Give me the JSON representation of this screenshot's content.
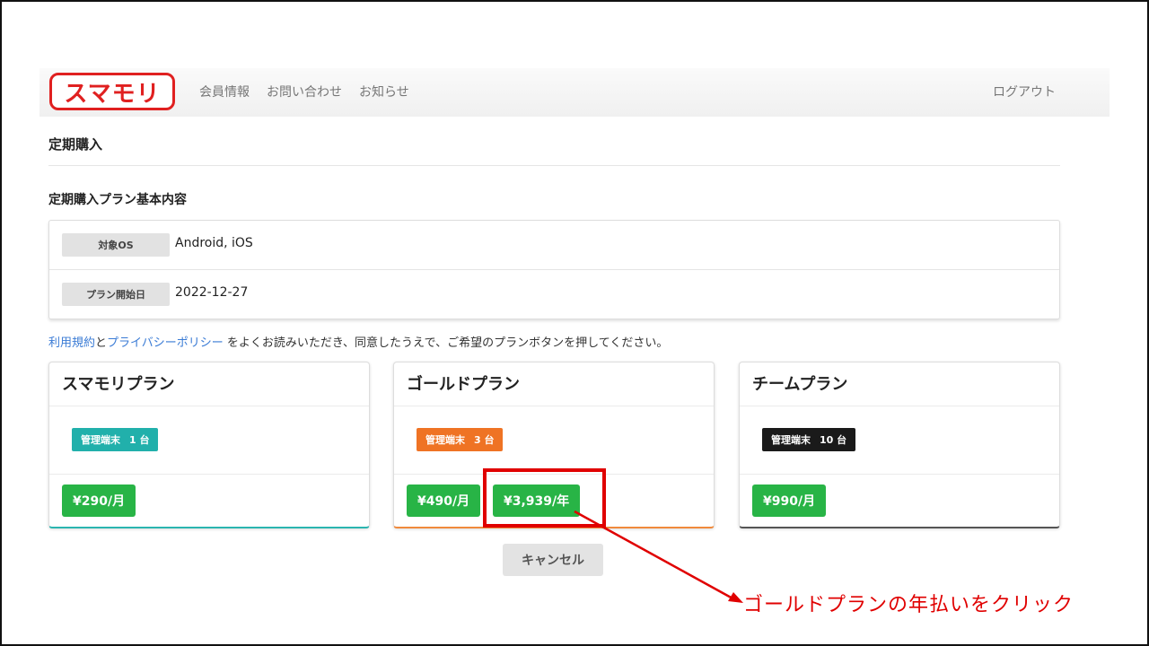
{
  "header": {
    "logo_text": "スマモリ",
    "nav": [
      "会員情報",
      "お問い合わせ",
      "お知らせ"
    ],
    "logout": "ログアウト"
  },
  "page": {
    "title": "定期購入",
    "section_title": "定期購入プラン基本内容"
  },
  "info": {
    "rows": [
      {
        "label": "対象OS",
        "value": "Android, iOS"
      },
      {
        "label": "プラン開始日",
        "value": "2022-12-27"
      }
    ]
  },
  "agreement": {
    "terms_link": "利用規約",
    "and": "と",
    "privacy_link": "プライバシーポリシー",
    "rest": " をよくお読みいただき、同意したうえで、ご希望のプランボタンを押してください。"
  },
  "plans": [
    {
      "name": "スマモリプラン",
      "badge_label": "管理端末",
      "badge_count": "1 台",
      "badge_color": "#21b0ab",
      "prices": [
        "¥290/月"
      ]
    },
    {
      "name": "ゴールドプラン",
      "badge_label": "管理端末",
      "badge_count": "3 台",
      "badge_color": "#ef7324",
      "prices": [
        "¥490/月",
        "¥3,939/年"
      ]
    },
    {
      "name": "チームプラン",
      "badge_label": "管理端末",
      "badge_count": "10 台",
      "badge_color": "#1a1a1a",
      "prices": [
        "¥990/月"
      ]
    }
  ],
  "cancel_label": "キャンセル",
  "annotation": {
    "text": "ゴールドプランの年払いをクリック",
    "color": "#e00000"
  }
}
